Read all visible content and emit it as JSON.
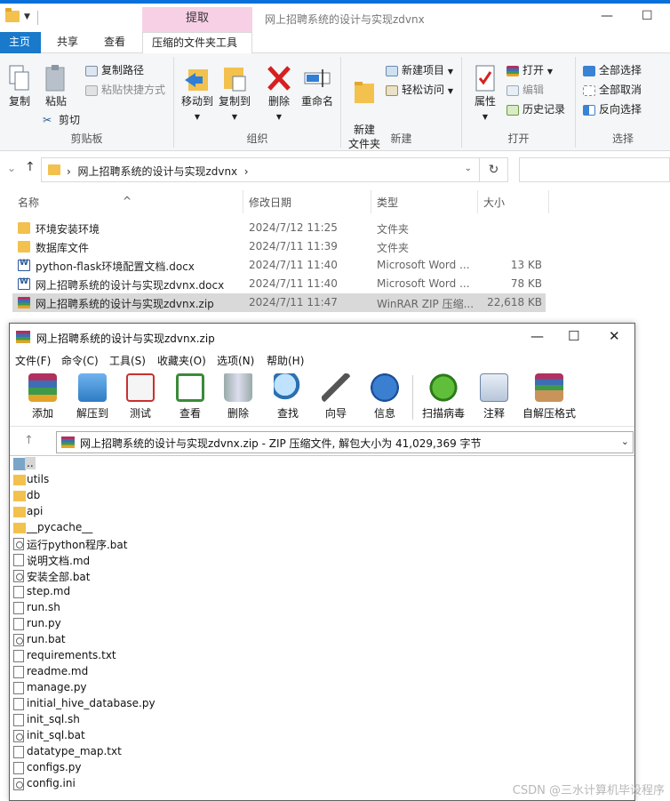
{
  "explorer": {
    "title": "网上招聘系统的设计与实现zdvnx",
    "context_tab_header": "提取",
    "window_controls": {
      "minimize": "—",
      "maximize": "☐"
    },
    "tabs": [
      "主页",
      "共享",
      "查看",
      "压缩的文件夹工具"
    ],
    "ribbon": {
      "clipboard": {
        "group": "剪贴板",
        "copy": "复制",
        "paste": "粘贴",
        "copy_path": "复制路径",
        "paste_shortcut": "粘贴快捷方式",
        "cut": "剪切"
      },
      "organize": {
        "group": "组织",
        "move_to": "移动到",
        "copy_to": "复制到",
        "delete": "删除",
        "rename": "重命名"
      },
      "new": {
        "group": "新建",
        "new_folder": "新建\n文件夹",
        "new_item": "新建项目",
        "easy_access": "轻松访问"
      },
      "open": {
        "group": "打开",
        "properties": "属性",
        "open": "打开",
        "edit": "编辑",
        "history": "历史记录"
      },
      "select": {
        "group": "选择",
        "select_all": "全部选择",
        "select_none": "全部取消",
        "invert": "反向选择"
      }
    },
    "address": {
      "path": "网上招聘系统的设计与实现zdvnx"
    },
    "columns": {
      "name": "名称",
      "date": "修改日期",
      "type": "类型",
      "size": "大小"
    },
    "files": [
      {
        "name": "环境安装环境",
        "date": "2024/7/12 11:25",
        "type": "文件夹",
        "size": "",
        "icon": "folder"
      },
      {
        "name": "数据库文件",
        "date": "2024/7/11 11:39",
        "type": "文件夹",
        "size": "",
        "icon": "folder"
      },
      {
        "name": "python-flask环境配置文档.docx",
        "date": "2024/7/11 11:40",
        "type": "Microsoft Word ...",
        "size": "13 KB",
        "icon": "word"
      },
      {
        "name": "网上招聘系统的设计与实现zdvnx.docx",
        "date": "2024/7/11 11:40",
        "type": "Microsoft Word ...",
        "size": "78 KB",
        "icon": "word"
      },
      {
        "name": "网上招聘系统的设计与实现zdvnx.zip",
        "date": "2024/7/11 11:47",
        "type": "WinRAR ZIP 压缩...",
        "size": "22,618 KB",
        "icon": "rar",
        "selected": true
      }
    ]
  },
  "winrar": {
    "title": "网上招聘系统的设计与实现zdvnx.zip",
    "menu": [
      "文件(F)",
      "命令(C)",
      "工具(S)",
      "收藏夹(O)",
      "选项(N)",
      "帮助(H)"
    ],
    "toolbar": [
      "添加",
      "解压到",
      "测试",
      "查看",
      "删除",
      "查找",
      "向导",
      "信息",
      "扫描病毒",
      "注释",
      "自解压格式"
    ],
    "path_text": "网上招聘系统的设计与实现zdvnx.zip - ZIP 压缩文件, 解包大小为 41,029,369 字节",
    "entries": [
      {
        "name": "..",
        "icon": "up"
      },
      {
        "name": "utils",
        "icon": "folder"
      },
      {
        "name": "db",
        "icon": "folder"
      },
      {
        "name": "api",
        "icon": "folder"
      },
      {
        "name": "__pycache__",
        "icon": "folder"
      },
      {
        "name": "运行python程序.bat",
        "icon": "bat"
      },
      {
        "name": "说明文档.md",
        "icon": "file"
      },
      {
        "name": "安装全部.bat",
        "icon": "bat"
      },
      {
        "name": "step.md",
        "icon": "file"
      },
      {
        "name": "run.sh",
        "icon": "file"
      },
      {
        "name": "run.py",
        "icon": "file"
      },
      {
        "name": "run.bat",
        "icon": "bat"
      },
      {
        "name": "requirements.txt",
        "icon": "file"
      },
      {
        "name": "readme.md",
        "icon": "file"
      },
      {
        "name": "manage.py",
        "icon": "file"
      },
      {
        "name": "initial_hive_database.py",
        "icon": "file"
      },
      {
        "name": "init_sql.sh",
        "icon": "file"
      },
      {
        "name": "init_sql.bat",
        "icon": "bat"
      },
      {
        "name": "datatype_map.txt",
        "icon": "file"
      },
      {
        "name": "configs.py",
        "icon": "file"
      },
      {
        "name": "config.ini",
        "icon": "bat"
      }
    ]
  },
  "watermark": "CSDN @三水计算机毕设程序",
  "colors": {
    "accent": "#1979ca",
    "context_tab": "#f8d0e6",
    "selected_row": "#d9d9d9",
    "folder": "#f2c14e"
  }
}
